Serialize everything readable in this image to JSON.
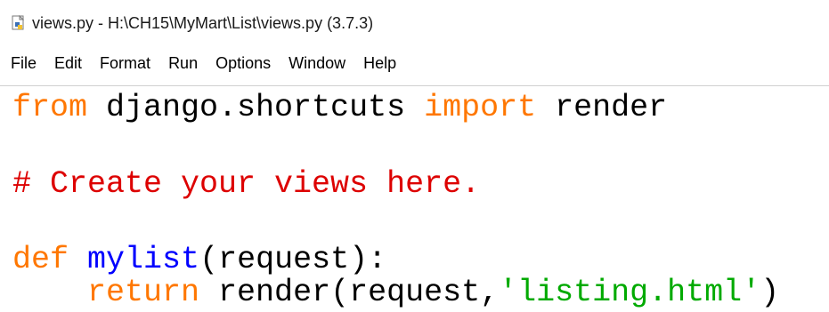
{
  "window": {
    "title": "views.py - H:\\CH15\\MyMart\\List\\views.py (3.7.3)",
    "icon": "python-file-icon"
  },
  "menubar": {
    "items": [
      "File",
      "Edit",
      "Format",
      "Run",
      "Options",
      "Window",
      "Help"
    ]
  },
  "colors": {
    "keyword": "#ff7700",
    "comment": "#dd0000",
    "definition": "#0000ff",
    "string": "#00aa00",
    "text": "#000000"
  },
  "code": {
    "line1": {
      "kw1": "from",
      "mod": " django.shortcuts ",
      "kw2": "import",
      "rest": " render"
    },
    "line3": {
      "comment": "# Create your views here."
    },
    "line5": {
      "kw": "def",
      "space": " ",
      "name": "mylist",
      "rest": "(request):"
    },
    "line6": {
      "indent": "    ",
      "kw": "return",
      "mid": " render(request,",
      "str": "'listing.html'",
      "end": ")"
    }
  }
}
